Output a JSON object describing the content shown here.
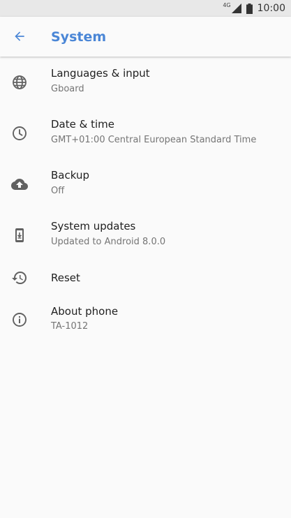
{
  "status_bar": {
    "network": "4G",
    "time": "10:00"
  },
  "app_bar": {
    "title": "System",
    "accent_color": "#4a86d6"
  },
  "settings": [
    {
      "icon": "globe-icon",
      "title": "Languages & input",
      "summary": "Gboard"
    },
    {
      "icon": "clock-icon",
      "title": "Date & time",
      "summary": "GMT+01:00 Central European Standard Time"
    },
    {
      "icon": "cloud-upload-icon",
      "title": "Backup",
      "summary": "Off"
    },
    {
      "icon": "system-update-icon",
      "title": "System updates",
      "summary": "Updated to Android 8.0.0"
    },
    {
      "icon": "restore-icon",
      "title": "Reset",
      "summary": ""
    },
    {
      "icon": "info-icon",
      "title": "About phone",
      "summary": "TA-1012"
    }
  ]
}
